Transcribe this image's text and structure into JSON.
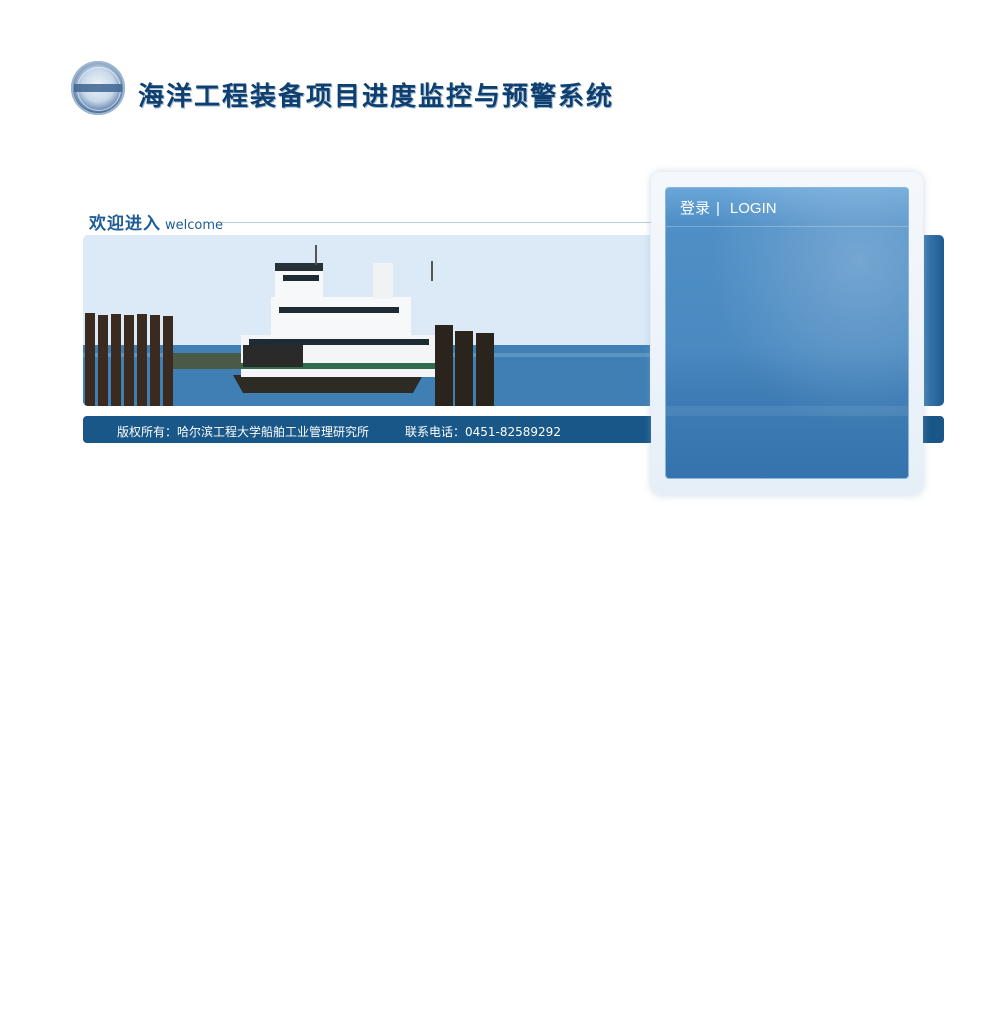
{
  "header": {
    "title": "海洋工程装备项目进度监控与预警系统",
    "logo_icon": "university-seal-icon"
  },
  "welcome": {
    "cn": "欢迎进入",
    "en": "welcome"
  },
  "banner": {
    "image": "ferry-ship-photo"
  },
  "footer": {
    "copyright": "版权所有：哈尔滨工程大学船舶工业管理研究所",
    "phone": "联系电话：0451-82589292"
  },
  "login": {
    "title_cn": "登录",
    "divider": "|",
    "title_en": "LOGIN"
  },
  "colors": {
    "brand_blue": "#185788",
    "title_blue": "#0e3f6e",
    "panel_blue": "#4a89c1"
  }
}
